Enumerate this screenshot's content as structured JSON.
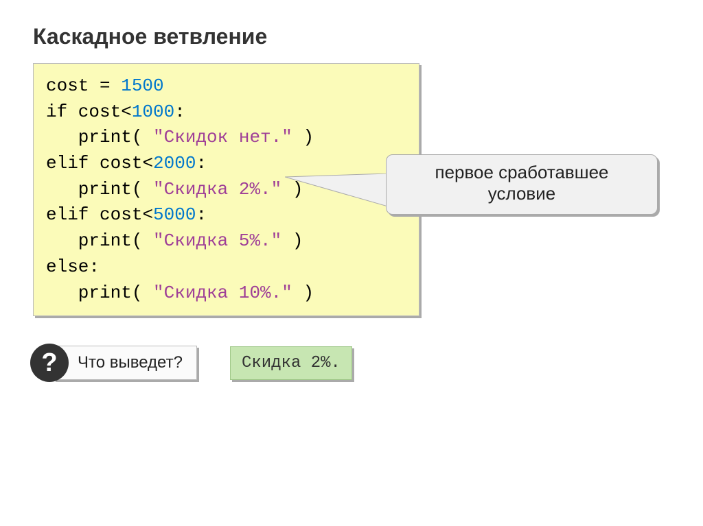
{
  "title": "Каскадное ветвление",
  "code": {
    "l1_a": "cost = ",
    "l1_num": "1500",
    "l2_a": "if cost",
    "l2_op": "<",
    "l2_num": "1000",
    "l2_c": ":",
    "l3_a": "   print( ",
    "l3_str": "\"Скидок нет.\"",
    "l3_b": " )",
    "l4_a": "elif cost",
    "l4_op": "<",
    "l4_num": "2000",
    "l4_c": ":",
    "l5_a": "   print( ",
    "l5_str": "\"Скидка 2%.\"",
    "l5_b": " )",
    "l6_a": "elif cost",
    "l6_op": "<",
    "l6_num": "5000",
    "l6_c": ":",
    "l7_a": "   print( ",
    "l7_str": "\"Скидка 5%.\"",
    "l7_b": " )",
    "l8_a": "else:",
    "l9_a": "   print( ",
    "l9_str": "\"Скидка 10%.\"",
    "l9_b": " )"
  },
  "callout": {
    "line1": "первое сработавшее",
    "line2": "условие"
  },
  "question_mark": "?",
  "question_label": "Что выведет?",
  "answer": "Скидка 2%."
}
